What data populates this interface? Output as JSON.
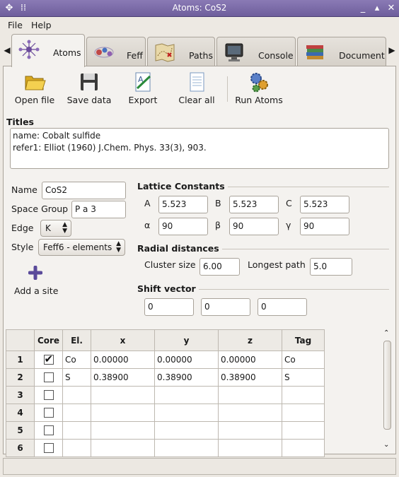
{
  "window": {
    "title": "Atoms: CoS2"
  },
  "menu": {
    "file": "File",
    "help": "Help"
  },
  "tabs": [
    {
      "label": "Atoms",
      "icon": "atoms-icon"
    },
    {
      "label": "Feff",
      "icon": "feff-icon"
    },
    {
      "label": "Paths",
      "icon": "paths-map-icon"
    },
    {
      "label": "Console",
      "icon": "console-monitor-icon"
    },
    {
      "label": "Document",
      "icon": "document-books-icon"
    }
  ],
  "toolbar": {
    "open_file": "Open file",
    "save_data": "Save data",
    "export": "Export",
    "clear_all": "Clear all",
    "run_atoms": "Run Atoms"
  },
  "titles": {
    "label": "Titles",
    "lines": [
      "name: Cobalt sulfide",
      "refer1: Elliot (1960) J.Chem. Phys. 33(3), 903."
    ]
  },
  "form": {
    "name_label": "Name",
    "name_value": "CoS2",
    "space_group_label": "Space Group",
    "space_group_value": "P a 3",
    "edge_label": "Edge",
    "edge_value": "K",
    "style_label": "Style",
    "style_value": "Feff6 - elements",
    "add_site_label": "Add a site"
  },
  "lattice": {
    "label": "Lattice Constants",
    "a_label": "A",
    "a": "5.523",
    "b_label": "B",
    "b": "5.523",
    "c_label": "C",
    "c": "5.523",
    "alpha_label": "α",
    "alpha": "90",
    "beta_label": "β",
    "beta": "90",
    "gamma_label": "γ",
    "gamma": "90"
  },
  "radial": {
    "label": "Radial distances",
    "cluster_label": "Cluster size",
    "cluster": "6.00",
    "longest_label": "Longest path",
    "longest": "5.0"
  },
  "shift": {
    "label": "Shift vector",
    "x": "0",
    "y": "0",
    "z": "0"
  },
  "grid": {
    "columns": [
      "Core",
      "El.",
      "x",
      "y",
      "z",
      "Tag"
    ],
    "rows": [
      {
        "num": "1",
        "core": true,
        "el": "Co",
        "x": "0.00000",
        "y": "0.00000",
        "z": "0.00000",
        "tag": "Co"
      },
      {
        "num": "2",
        "core": false,
        "el": "S",
        "x": "0.38900",
        "y": "0.38900",
        "z": "0.38900",
        "tag": "S"
      },
      {
        "num": "3",
        "core": false,
        "el": "",
        "x": "",
        "y": "",
        "z": "",
        "tag": ""
      },
      {
        "num": "4",
        "core": false,
        "el": "",
        "x": "",
        "y": "",
        "z": "",
        "tag": ""
      },
      {
        "num": "5",
        "core": false,
        "el": "",
        "x": "",
        "y": "",
        "z": "",
        "tag": ""
      },
      {
        "num": "6",
        "core": false,
        "el": "",
        "x": "",
        "y": "",
        "z": "",
        "tag": ""
      }
    ]
  },
  "colors": {
    "titlebar": "#7b6ba8",
    "accent": "#4a3a8c"
  }
}
